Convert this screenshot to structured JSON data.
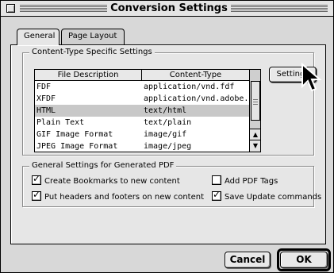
{
  "window": {
    "title": "Conversion Settings"
  },
  "tabs": [
    {
      "label": "General",
      "active": true
    },
    {
      "label": "Page Layout",
      "active": false
    }
  ],
  "content_type_group": {
    "label": "Content-Type Specific Settings",
    "columns": [
      "File Description",
      "Content-Type"
    ],
    "rows": [
      {
        "description": "FDF",
        "type": "application/vnd.fdf",
        "selected": false
      },
      {
        "description": "XFDF",
        "type": "application/vnd.adobe.xfdf",
        "selected": false
      },
      {
        "description": "HTML",
        "type": "text/html",
        "selected": true
      },
      {
        "description": "Plain Text",
        "type": "text/plain",
        "selected": false
      },
      {
        "description": "GIF Image Format",
        "type": "image/gif",
        "selected": false
      },
      {
        "description": "JPEG Image Format",
        "type": "image/jpeg",
        "selected": false
      }
    ],
    "settings_button": "Settings"
  },
  "general_group": {
    "label": "General Settings for Generated PDF",
    "options": [
      {
        "label": "Create Bookmarks to new content",
        "checked": true
      },
      {
        "label": "Put headers and footers on new content",
        "checked": true
      },
      {
        "label": "Add PDF Tags",
        "checked": false
      },
      {
        "label": "Save Update commands",
        "checked": true
      }
    ]
  },
  "footer": {
    "cancel_label": "Cancel",
    "ok_label": "OK"
  },
  "icons": {
    "close_box": "close-box-icon",
    "cursor": "arrow-cursor-icon",
    "check": "checkmark-icon"
  }
}
